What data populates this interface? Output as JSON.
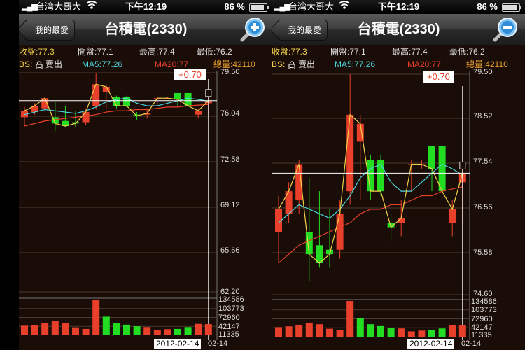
{
  "status_bar": {
    "signal": "▂▄▆",
    "carrier": "台湾大哥大",
    "wifi": "wifi-icon",
    "time": "下午12:19",
    "battery": "86 %",
    "battery_level": 0.86
  },
  "nav": {
    "back_label": "我的最愛",
    "title": "台積電(2330)"
  },
  "stock_info": {
    "close": "收盤:77.3",
    "open": "開盤:77.1",
    "high": "最高:77.4",
    "low": "最低:76.2",
    "bs_label": "BS:",
    "bs_value": "賣出",
    "ma5": "MA5:77.26",
    "ma20": "MA20:77",
    "volume": "總量:42110"
  },
  "left_panel": {
    "zoom": "zoom-in-icon",
    "change": "+0.70",
    "date": "2012-02-14",
    "date_tail": "02-14",
    "price_ticks": [
      "79.50",
      "76.04",
      "72.58",
      "69.12",
      "65.66",
      "62.20"
    ],
    "volume_ticks": [
      "134586",
      "103773",
      "72960",
      "42147",
      "11335"
    ]
  },
  "right_panel": {
    "zoom": "zoom-out-icon",
    "change": "+0.70",
    "date": "2012-02-14",
    "date_tail": "02-14",
    "price_ticks": [
      "79.50",
      "78.52",
      "77.54",
      "76.56",
      "75.58",
      "74.60"
    ],
    "volume_ticks": [
      "134586",
      "103773",
      "72960",
      "42147",
      "11335"
    ]
  },
  "chart_data": {
    "type": "candlestick",
    "up_color": "#e8402a",
    "down_color": "#22dd22",
    "ma5_color": "#4cd6e0",
    "ma20_color": "#e8402a",
    "close_line_color": "#f0d24a",
    "candles": [
      {
        "o": 76.0,
        "h": 76.8,
        "l": 75.3,
        "c": 76.5
      },
      {
        "o": 76.4,
        "h": 77.1,
        "l": 76.2,
        "c": 76.9
      },
      {
        "o": 76.7,
        "h": 77.6,
        "l": 76.4,
        "c": 77.5
      },
      {
        "o": 76.0,
        "h": 77.2,
        "l": 74.9,
        "c": 75.5
      },
      {
        "o": 75.7,
        "h": 76.9,
        "l": 75.2,
        "c": 75.3
      },
      {
        "o": 75.6,
        "h": 76.5,
        "l": 75.2,
        "c": 75.5
      },
      {
        "o": 75.6,
        "h": 76.7,
        "l": 75.4,
        "c": 76.4
      },
      {
        "o": 76.9,
        "h": 79.5,
        "l": 76.6,
        "c": 78.6
      },
      {
        "o": 78.0,
        "h": 78.6,
        "l": 76.7,
        "c": 78.4
      },
      {
        "o": 77.6,
        "h": 77.7,
        "l": 76.7,
        "c": 76.9
      },
      {
        "o": 77.6,
        "h": 77.7,
        "l": 76.8,
        "c": 76.9
      },
      {
        "o": 76.2,
        "h": 76.4,
        "l": 75.8,
        "c": 76.1
      },
      {
        "o": 76.2,
        "h": 76.7,
        "l": 75.9,
        "c": 76.3
      },
      {
        "o": 77.5,
        "h": 77.6,
        "l": 76.9,
        "c": 77.5
      },
      {
        "o": 77.5,
        "h": 77.6,
        "l": 77.4,
        "c": 77.5
      },
      {
        "o": 77.9,
        "h": 77.9,
        "l": 76.9,
        "c": 77.4
      },
      {
        "o": 77.9,
        "h": 77.9,
        "l": 76.9,
        "c": 76.9
      },
      {
        "o": 76.2,
        "h": 76.7,
        "l": 75.9,
        "c": 76.5
      },
      {
        "o": 77.1,
        "h": 77.4,
        "l": 76.2,
        "c": 77.3
      }
    ],
    "ma5": [
      76.2,
      76.4,
      76.6,
      76.5,
      76.4,
      76.3,
      76.5,
      76.8,
      77.2,
      77.4,
      77.5,
      77.1,
      76.9,
      76.9,
      77.1,
      77.3,
      77.5,
      77.4,
      77.26
    ],
    "ma20": [
      75.3,
      75.5,
      75.7,
      75.8,
      75.9,
      76.0,
      76.1,
      76.2,
      76.4,
      76.5,
      76.5,
      76.6,
      76.6,
      76.7,
      76.8,
      76.8,
      76.9,
      76.95,
      77.0
    ],
    "volumes": [
      36000,
      39000,
      45000,
      53000,
      47000,
      30000,
      24000,
      134586,
      70000,
      47000,
      40000,
      34000,
      31000,
      20000,
      23000,
      24000,
      31000,
      43000,
      42110
    ],
    "volume_colors": [
      "up",
      "up",
      "up",
      "up",
      "up",
      "up",
      "up",
      "up",
      "down",
      "down",
      "down",
      "down",
      "up",
      "up",
      "up",
      "down",
      "down",
      "up",
      "up"
    ]
  }
}
